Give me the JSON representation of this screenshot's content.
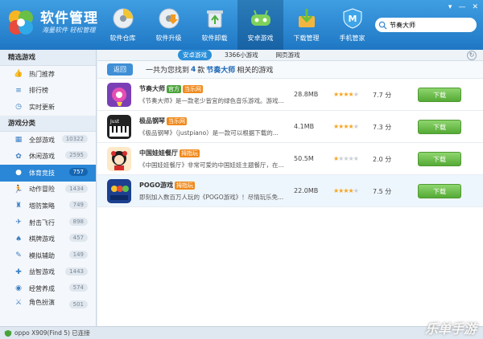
{
  "app": {
    "title": "软件管理",
    "slogan": "海量软件 轻松管理"
  },
  "tabs": [
    {
      "label": "软件仓库",
      "icon": "disc-icon"
    },
    {
      "label": "软件升级",
      "icon": "upgrade-disc-icon"
    },
    {
      "label": "软件卸载",
      "icon": "recycle-bin-icon"
    },
    {
      "label": "安卓游戏",
      "icon": "android-gamepad-icon"
    },
    {
      "label": "下载管理",
      "icon": "download-box-icon"
    },
    {
      "label": "手机管家",
      "icon": "phone-shield-icon"
    }
  ],
  "window_controls": {
    "menu": "▾",
    "minimize": "—",
    "close": "✕"
  },
  "search": {
    "value": "节奏大师"
  },
  "sidebar": {
    "section1": "精选游戏",
    "featured": [
      {
        "label": "热门推荐"
      },
      {
        "label": "排行榜"
      },
      {
        "label": "实时更新"
      }
    ],
    "section2": "游戏分类",
    "categories": [
      {
        "label": "全部游戏",
        "count": "10322"
      },
      {
        "label": "休闲游戏",
        "count": "2595"
      },
      {
        "label": "体育竞技",
        "count": "757"
      },
      {
        "label": "动作冒险",
        "count": "1434"
      },
      {
        "label": "塔防策略",
        "count": "749"
      },
      {
        "label": "射击飞行",
        "count": "898"
      },
      {
        "label": "棋牌游戏",
        "count": "457"
      },
      {
        "label": "模拟辅助",
        "count": "149"
      },
      {
        "label": "益智游戏",
        "count": "1443"
      },
      {
        "label": "经营养成",
        "count": "574"
      },
      {
        "label": "角色扮演",
        "count": "501"
      }
    ]
  },
  "subtabs": [
    {
      "label": "安卓游戏"
    },
    {
      "label": "3366小游戏"
    },
    {
      "label": "网页游戏"
    }
  ],
  "result": {
    "back": "返回",
    "prefix": "一共为您找到",
    "count": "4",
    "middle": "款",
    "keyword": "节奏大师",
    "suffix": "相关的游戏"
  },
  "download_label": "下载",
  "games": [
    {
      "name": "节奏大师",
      "badges": [
        {
          "text": "官方",
          "color": "#4aa33a"
        },
        {
          "text": "当乐网",
          "color": "#f08a1c"
        }
      ],
      "desc": "《节奏大师》是一款老少皆宜的绿色音乐游戏。游戏...",
      "size": "28.8MB",
      "rating": 4,
      "score": "7.7 分"
    },
    {
      "name": "极品钢琴",
      "badges": [
        {
          "text": "当乐网",
          "color": "#f08a1c"
        }
      ],
      "desc": "《极品钢琴》（justpiano）是一款可以根据下载的...",
      "size": "4.1MB",
      "rating": 4,
      "score": "7.3 分"
    },
    {
      "name": "中国娃娃餐厅",
      "badges": [
        {
          "text": "拇指玩",
          "color": "#f08a1c"
        }
      ],
      "desc": "《中国娃娃餐厅》非常可爱的中国娃娃主题餐厅，在...",
      "size": "50.5M",
      "rating": 1,
      "score": "2.0 分"
    },
    {
      "name": "POGO游戏",
      "badges": [
        {
          "text": "拇指玩",
          "color": "#f08a1c"
        }
      ],
      "desc": "即刻加入数百万人玩的《POGO游戏》！尽情玩乐免...",
      "size": "22.0MB",
      "rating": 4,
      "score": "7.5 分"
    }
  ],
  "status": {
    "device": "oppo X909(Find 5) 已连接"
  },
  "watermark": "乐单手游"
}
